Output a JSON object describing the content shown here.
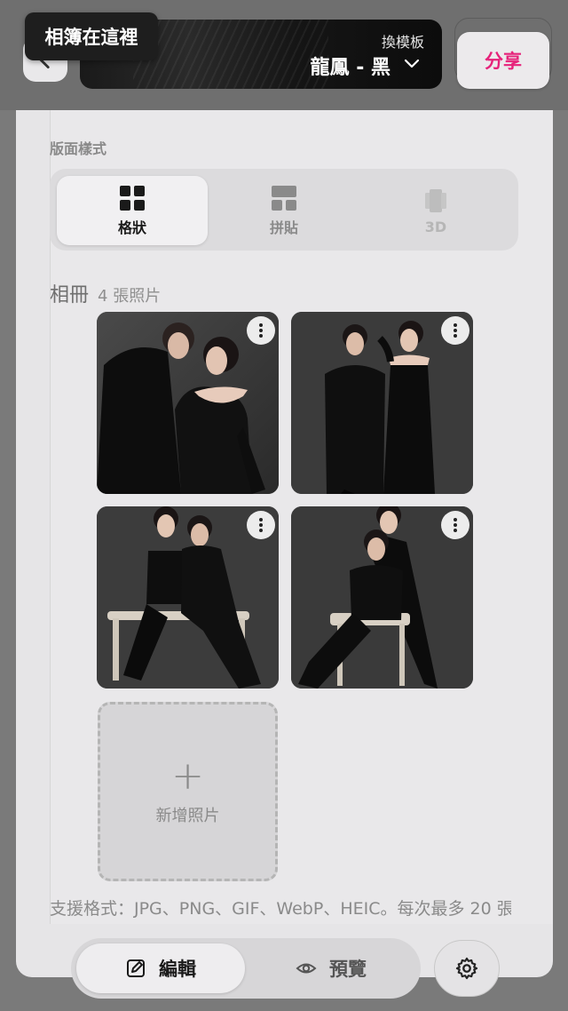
{
  "header": {
    "tooltip_label": "相簿在這裡",
    "template": {
      "change_label": "換模板",
      "name": "龍鳳 - 黑"
    },
    "share_label": "分享"
  },
  "layout_style": {
    "section_label": "版面樣式",
    "tabs": [
      {
        "label": "格狀",
        "icon": "grid-icon",
        "state": "active"
      },
      {
        "label": "拼貼",
        "icon": "collage-icon",
        "state": "inactive"
      },
      {
        "label": "3D",
        "icon": "3d-icon",
        "state": "disabled"
      }
    ]
  },
  "album": {
    "title": "相冊",
    "count_text": "4 張照片",
    "photos": [
      {
        "alt": "couple photo 1"
      },
      {
        "alt": "couple photo 2"
      },
      {
        "alt": "couple photo 3"
      },
      {
        "alt": "couple photo 4"
      }
    ],
    "add_photo_label": "新增照片",
    "formats_note": "支援格式：JPG、PNG、GIF、WebP、HEIC。每次最多 20 張"
  },
  "bottom_nav": {
    "edit_label": "編輯",
    "preview_label": "預覽",
    "settings_icon": "gear-icon"
  },
  "colors": {
    "accent": "#e6227a",
    "panel": "#e9e8ea"
  }
}
